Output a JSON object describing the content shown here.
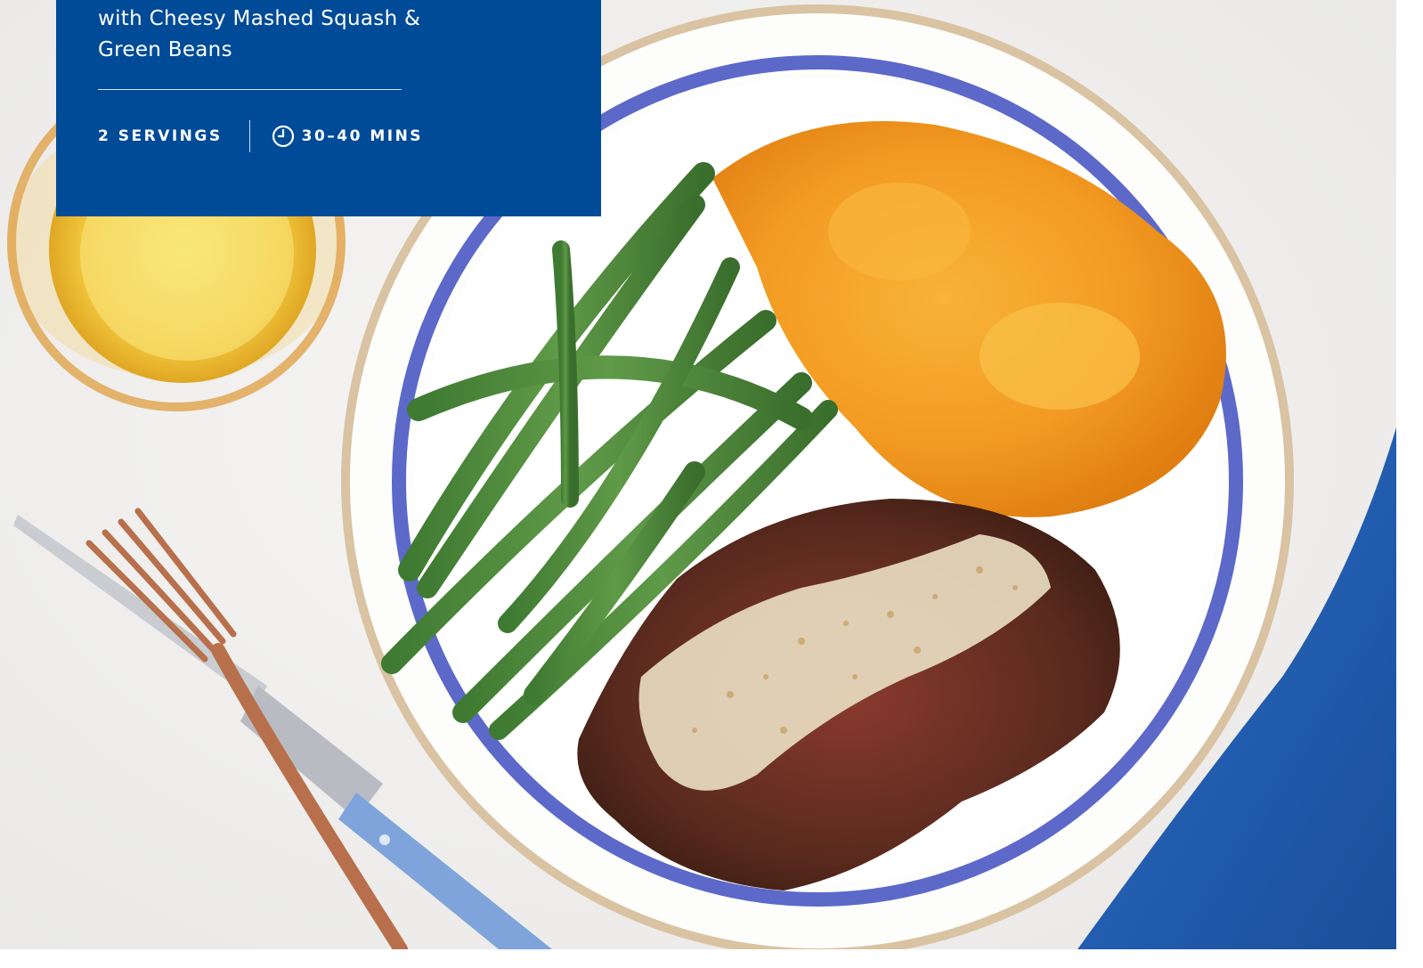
{
  "card": {
    "subtitle": "with Cheesy Mashed Squash & Green Beans",
    "servings": "2 SERVINGS",
    "time": "30–40 MINS",
    "background": "#004b97"
  },
  "photo": {
    "description_icon": "plated-steak-photo"
  },
  "icons": {
    "clock": "clock-icon"
  }
}
